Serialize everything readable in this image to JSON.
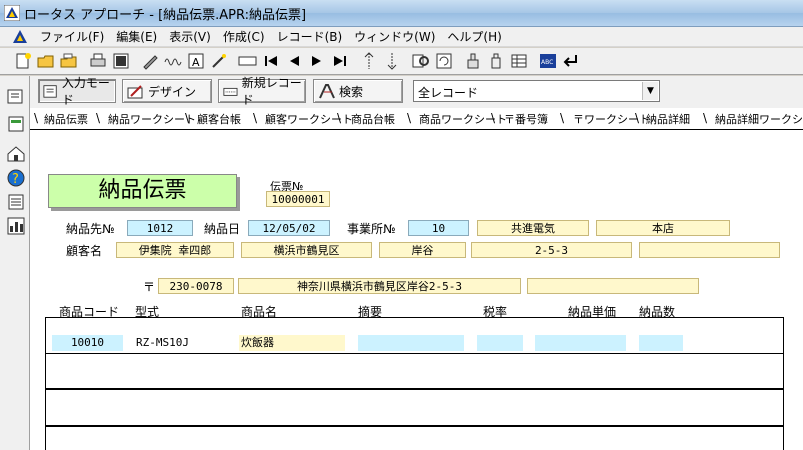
{
  "window": {
    "title": "ロータス アプローチ - [納品伝票.APR:納品伝票]"
  },
  "menu": {
    "items": [
      "ファイル(F)",
      "編集(E)",
      "表示(V)",
      "作成(C)",
      "レコード(B)",
      "ウィンドウ(W)",
      "ヘルプ(H)"
    ]
  },
  "toolbar": {
    "icons": [
      "new-file-icon",
      "open-folder-icon",
      "open-folder-icon",
      "print-icon",
      "preview-icon",
      "pen-icon",
      "wave-icon",
      "text-icon",
      "wand-icon",
      "field-icon",
      "first-record-icon",
      "prev-record-icon",
      "next-record-icon",
      "last-record-icon",
      "sort-asc-icon",
      "sort-desc-icon",
      "find-icon",
      "refresh-icon",
      "stamp-icon",
      "bottle-icon",
      "grid-icon",
      "abc-icon",
      "enter-icon"
    ]
  },
  "actions": {
    "input_mode": "入力モード",
    "design": "デザイン",
    "new_record": "新規レコード",
    "search": "検索",
    "view_select": "全レコード"
  },
  "tabs": [
    "納品伝票",
    "納品ワークシート",
    "顧客台帳",
    "顧客ワークシート",
    "商品台帳",
    "商品ワークシート",
    "〒番号簿",
    "〒ワークシート",
    "納品詳細",
    "納品詳細ワークシート"
  ],
  "form": {
    "title": "納品伝票",
    "slip_no_label": "伝票№",
    "slip_no": "10000001",
    "delivery_no_label": "納品先№",
    "delivery_no": "1012",
    "delivery_date_label": "納品日",
    "delivery_date": "12/05/02",
    "office_no_label": "事業所№",
    "office_no": "10",
    "company": "共進電気",
    "branch": "本店",
    "customer_label": "顧客名",
    "customer_name": "伊集院 幸四郎",
    "customer_city": "横浜市鶴見区",
    "customer_area": "岸谷",
    "customer_block": "2-5-3",
    "postal_mark": "〒",
    "postal_code": "230-0078",
    "address": "神奈川県横浜市鶴見区岸谷2-5-3"
  },
  "detail": {
    "headers": [
      "商品コード",
      "型式",
      "商品名",
      "摘要",
      "税率",
      "納品単価",
      "納品数"
    ],
    "row": {
      "code": "10010",
      "model": "RZ-MS10J",
      "name": "炊飯器"
    }
  }
}
